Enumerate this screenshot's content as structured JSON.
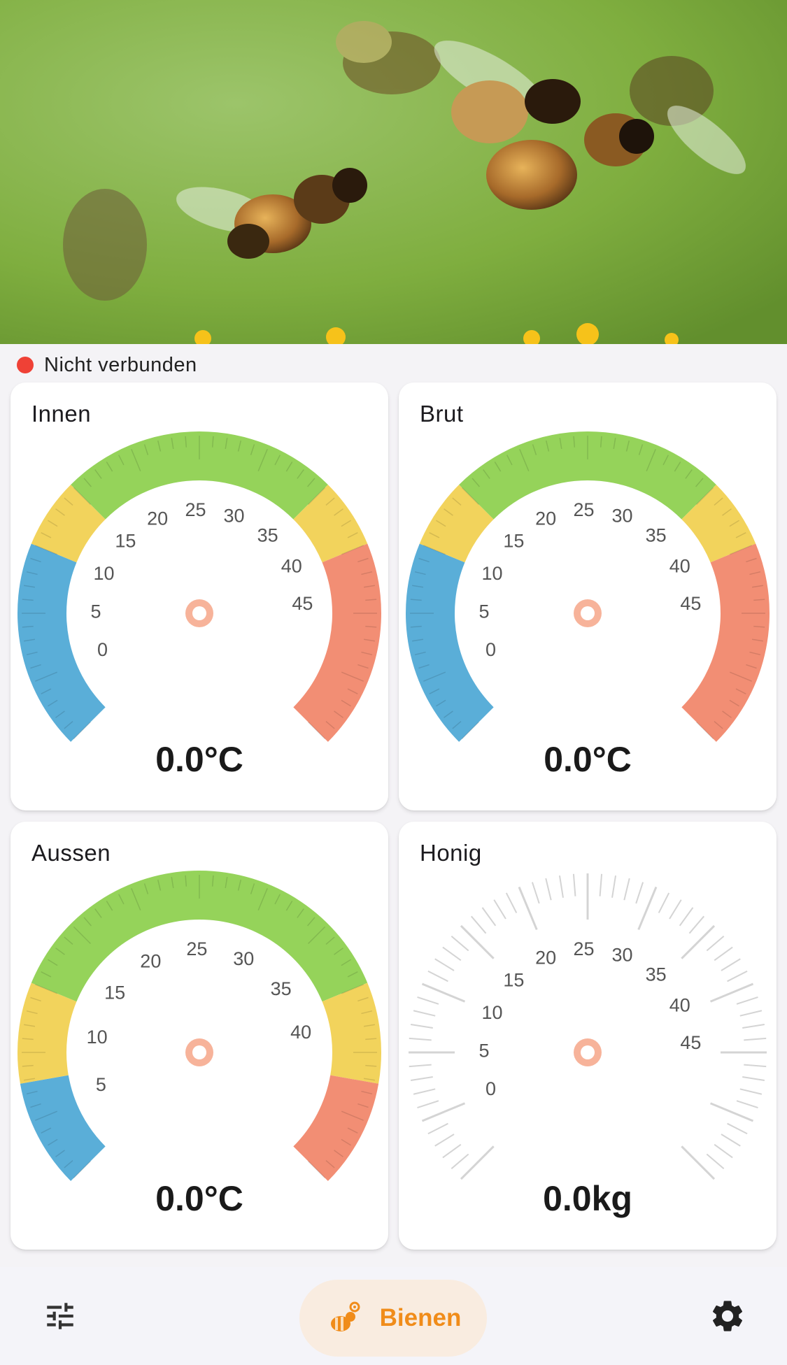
{
  "status": {
    "text": "Nicht verbunden",
    "connected": false,
    "color": "#ef4136"
  },
  "gauges": [
    {
      "id": "innen",
      "title": "Innen",
      "readout": "0.0°C",
      "value": 0,
      "min": 0,
      "max": 50,
      "ticks": [
        "0",
        "5",
        "10",
        "15",
        "20",
        "25",
        "30",
        "35",
        "40",
        "45"
      ],
      "style": "colored",
      "bands": [
        {
          "from": 0,
          "to": 15,
          "color": "#5aaed8"
        },
        {
          "from": 15,
          "to": 20,
          "color": "#f2d35c"
        },
        {
          "from": 20,
          "to": 40,
          "color": "#95d35a"
        },
        {
          "from": 40,
          "to": 45,
          "color": "#f2d35c"
        },
        {
          "from": 45,
          "to": 60,
          "color": "#f28e74"
        }
      ]
    },
    {
      "id": "brut",
      "title": "Brut",
      "readout": "0.0°C",
      "value": 0,
      "min": 0,
      "max": 50,
      "ticks": [
        "0",
        "5",
        "10",
        "15",
        "20",
        "25",
        "30",
        "35",
        "40",
        "45"
      ],
      "style": "colored",
      "bands": [
        {
          "from": 0,
          "to": 15,
          "color": "#5aaed8"
        },
        {
          "from": 15,
          "to": 20,
          "color": "#f2d35c"
        },
        {
          "from": 20,
          "to": 40,
          "color": "#95d35a"
        },
        {
          "from": 40,
          "to": 45,
          "color": "#f2d35c"
        },
        {
          "from": 45,
          "to": 60,
          "color": "#f28e74"
        }
      ]
    },
    {
      "id": "aussen",
      "title": "Aussen",
      "readout": "0.0°C",
      "value": 0,
      "min": 5,
      "max": 45,
      "ticks": [
        "5",
        "10",
        "15",
        "20",
        "25",
        "30",
        "35",
        "40"
      ],
      "style": "colored",
      "bands": [
        {
          "from": 0,
          "to": 13,
          "color": "#5aaed8"
        },
        {
          "from": 13,
          "to": 25,
          "color": "#f2d35c"
        },
        {
          "from": 25,
          "to": 75,
          "color": "#95d35a"
        },
        {
          "from": 75,
          "to": 87,
          "color": "#f2d35c"
        },
        {
          "from": 87,
          "to": 100,
          "color": "#f28e74"
        }
      ]
    },
    {
      "id": "honig",
      "title": "Honig",
      "readout": "0.0kg",
      "value": 0,
      "min": 0,
      "max": 50,
      "ticks": [
        "0",
        "5",
        "10",
        "15",
        "20",
        "25",
        "30",
        "35",
        "40",
        "45"
      ],
      "style": "ticks",
      "bands": []
    }
  ],
  "needle_color": "#f7b39a",
  "nav": {
    "left_icon": "tune-icon",
    "center_icon": "bee-icon",
    "center_label": "Bienen",
    "right_icon": "gear-icon",
    "accent": "#f08c1a"
  }
}
